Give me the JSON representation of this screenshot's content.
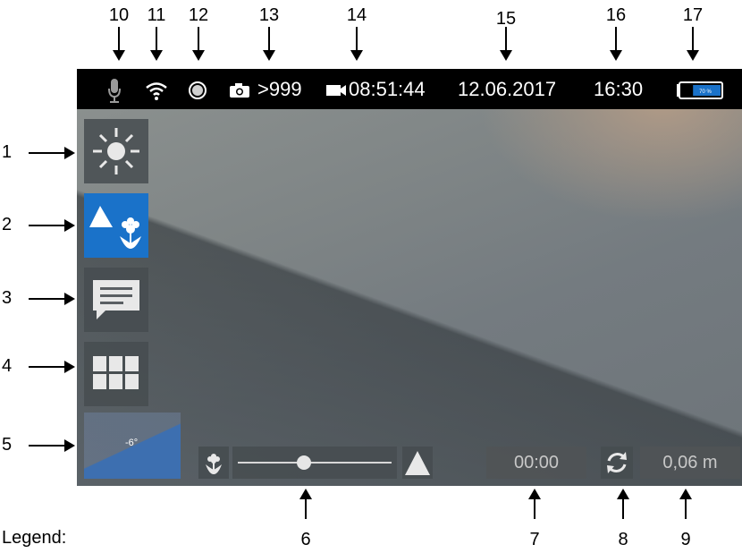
{
  "top_callouts": [
    "10",
    "11",
    "12",
    "13",
    "14",
    "15",
    "16",
    "17"
  ],
  "left_callouts": [
    "1",
    "2",
    "3",
    "4",
    "5"
  ],
  "bottom_callouts": [
    "6",
    "7",
    "8",
    "9"
  ],
  "legend_label": "Legend:",
  "status_bar": {
    "photo_count": ">999",
    "video_time": "08:51:44",
    "date": "12.06.2017",
    "time": "16:30",
    "battery_text": "70 %",
    "battery_level_percent": 70
  },
  "side_buttons": [
    {
      "name": "brightness",
      "icon": "brightness-icon",
      "active": false
    },
    {
      "name": "focus-mode",
      "icon": "landscape-macro-icon",
      "active": true
    },
    {
      "name": "comments",
      "icon": "comment-icon",
      "active": false
    },
    {
      "name": "grid",
      "icon": "grid-icon",
      "active": false
    }
  ],
  "incline": {
    "value": "-6°"
  },
  "zoom": {
    "near_icon": "macro-flower-icon",
    "far_icon": "mountain-icon",
    "level": 0.42
  },
  "timer": {
    "value": "00:00"
  },
  "rotate": {
    "icon": "rotate-icon"
  },
  "distance": {
    "value": "0,06 m"
  },
  "colors": {
    "accent": "#1a72c9",
    "status_bar": "#000000",
    "battery": "#1a72c9"
  }
}
